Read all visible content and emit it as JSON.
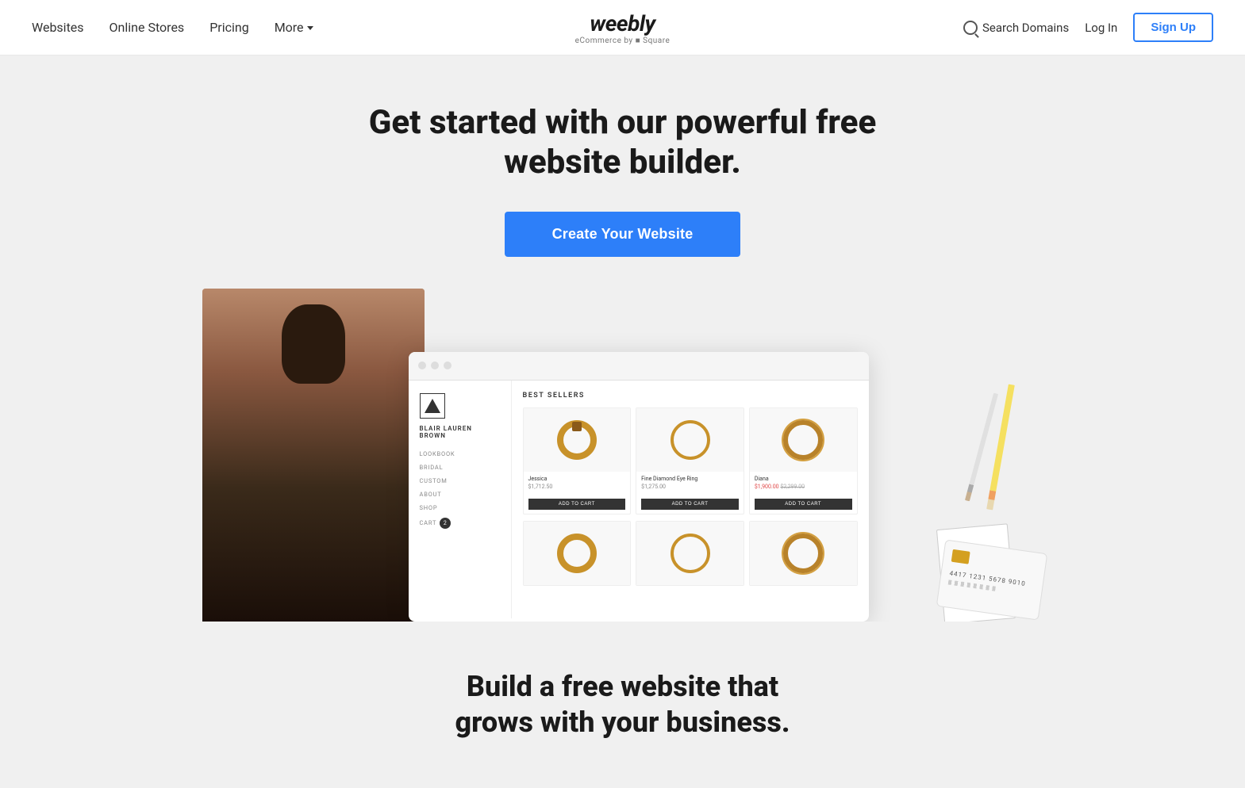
{
  "brand": {
    "name": "weebly",
    "sub": "eCommerce by ■ Square"
  },
  "nav": {
    "links": [
      {
        "id": "websites",
        "label": "Websites"
      },
      {
        "id": "online-stores",
        "label": "Online Stores"
      },
      {
        "id": "pricing",
        "label": "Pricing"
      },
      {
        "id": "more",
        "label": "More"
      }
    ],
    "search_label": "Search Domains",
    "login_label": "Log In",
    "signup_label": "Sign Up"
  },
  "hero": {
    "headline_line1": "Get started with our powerful free",
    "headline_line2": "website builder.",
    "cta_label": "Create Your Website"
  },
  "store_demo": {
    "browser_dots": [
      "#e0e0e0",
      "#e0e0e0",
      "#e0e0e0"
    ],
    "store_name": "BLAIR LAUREN BROWN",
    "nav_items": [
      "LOOKBOOK",
      "BRIDAL",
      "CUSTOM",
      "ABOUT",
      "SHOP"
    ],
    "cart_label": "CART",
    "cart_count": "2",
    "section_label": "BEST SELLERS",
    "products": [
      {
        "name": "Jessica",
        "price": "$1,712.50",
        "is_sale": false,
        "cta": "ADD TO CART",
        "ring_type": "with-gem"
      },
      {
        "name": "Fine Diamond Eye Ring",
        "price": "$1,275.00",
        "is_sale": false,
        "cta": "ADD TO CART",
        "ring_type": "thin"
      },
      {
        "name": "Diana",
        "sale_price": "$1,900.00",
        "original_price": "$2,299.00",
        "is_sale": true,
        "cta": "ADD TO CART",
        "ring_type": "studded"
      }
    ]
  },
  "bottom": {
    "headline_line1": "Build a free website that",
    "headline_line2": "grows with your business."
  },
  "colors": {
    "cta_blue": "#2d7ff9",
    "text_dark": "#1a1a1a",
    "bg_light": "#f0f0f0"
  }
}
